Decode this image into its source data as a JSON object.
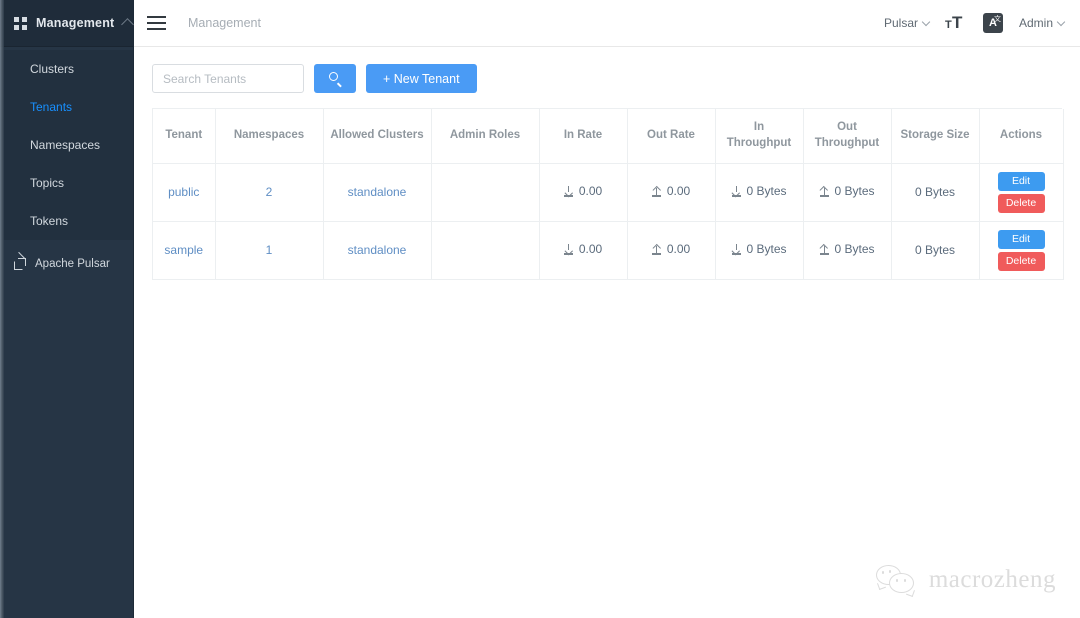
{
  "sidebar": {
    "header": {
      "title": "Management",
      "grid_icon": "grid-icon",
      "chevron_icon": "chevron-up-icon"
    },
    "items": [
      {
        "label": "Clusters",
        "active": false
      },
      {
        "label": "Tenants",
        "active": true
      },
      {
        "label": "Namespaces",
        "active": false
      },
      {
        "label": "Topics",
        "active": false
      },
      {
        "label": "Tokens",
        "active": false
      }
    ],
    "footer": {
      "label": "Apache Pulsar",
      "icon": "external-link-icon"
    },
    "bg_color": "#263545",
    "active_color": "#1890ff"
  },
  "topbar": {
    "menu_icon": "hamburger-icon",
    "breadcrumb": "Management",
    "cluster_selector": "Pulsar",
    "font_size_icon": "font-size-icon",
    "language_icon": "translate-icon",
    "language_glyph": "A",
    "language_sup": "文",
    "user_menu": "Admin"
  },
  "toolbar": {
    "search_placeholder": "Search Tenants",
    "search_value": "",
    "search_button_icon": "search-icon",
    "new_tenant_label": "+ New Tenant",
    "accent_color": "#4a9bf5"
  },
  "table": {
    "columns": [
      "Tenant",
      "Namespaces",
      "Allowed Clusters",
      "Admin Roles",
      "In Rate",
      "Out Rate",
      "In Throughput",
      "Out Throughput",
      "Storage Size",
      "Actions"
    ],
    "rows": [
      {
        "tenant": "public",
        "namespaces": "2",
        "allowed_clusters": "standalone",
        "admin_roles": "",
        "in_rate": "0.00",
        "out_rate": "0.00",
        "in_throughput": "0 Bytes",
        "out_throughput": "0 Bytes",
        "storage_size": "0 Bytes",
        "edit_label": "Edit",
        "delete_label": "Delete"
      },
      {
        "tenant": "sample",
        "namespaces": "1",
        "allowed_clusters": "standalone",
        "admin_roles": "",
        "in_rate": "0.00",
        "out_rate": "0.00",
        "in_throughput": "0 Bytes",
        "out_throughput": "0 Bytes",
        "storage_size": "0 Bytes",
        "edit_label": "Edit",
        "delete_label": "Delete"
      }
    ],
    "edit_color": "#3d9bf0",
    "delete_color": "#f05b5b",
    "link_color": "#5f8ec4"
  },
  "watermark": {
    "text": "macrozheng",
    "icon": "wechat-icon",
    "color": "#dcdcdc"
  }
}
